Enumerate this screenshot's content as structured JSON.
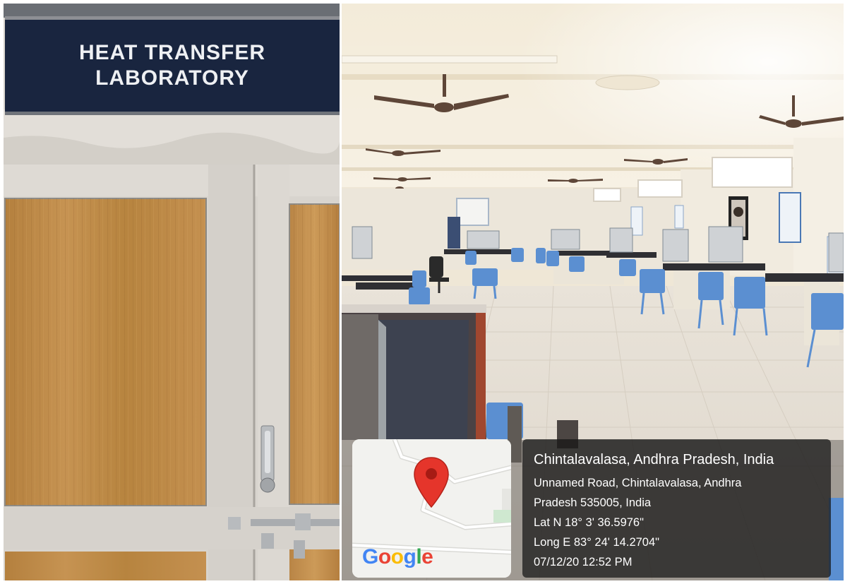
{
  "sign": {
    "line1": "HEAT TRANSFER",
    "line2": "LABORATORY"
  },
  "geotag": {
    "map_logo": "Google",
    "place": "Chintalavalasa, Andhra Pradesh, India",
    "address_line1": "Unnamed Road, Chintalavalasa, Andhra",
    "address_line2": "Pradesh 535005, India",
    "latitude": "Lat N 18° 3' 36.5976\"",
    "longitude": "Long E 83° 24' 14.2704\"",
    "datetime": "07/12/20 12:52 PM"
  },
  "icons": {
    "map_pin": "map-pin-icon"
  },
  "colors": {
    "sign_background": "#19253f",
    "map_pin": "#e5352b",
    "overlay": "#141414",
    "chairs": "#5b8fd1"
  }
}
